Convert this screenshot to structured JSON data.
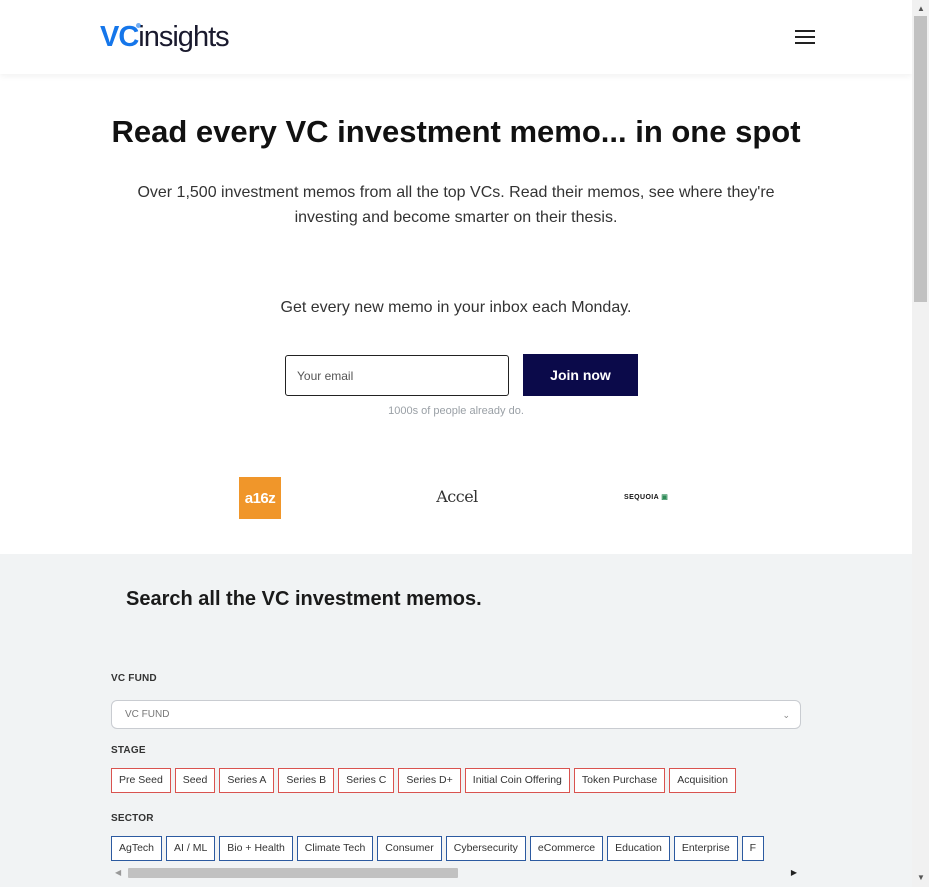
{
  "header": {
    "logo_vc": "VC",
    "logo_rest": "insights",
    "menu_icon": "hamburger-menu-icon"
  },
  "hero": {
    "title": "Read every VC investment memo... in one spot",
    "subtitle": "Over 1,500 investment memos from all the top VCs. Read their memos, see where they're investing and become smarter on their thesis.",
    "inbox_text": "Get every new memo in your inbox each Monday.",
    "email_placeholder": "Your email",
    "join_label": "Join now",
    "social_proof": "1000s of people already do."
  },
  "fund_logos": {
    "a16z": "a16z",
    "accel": "Accel",
    "sequoia": "SEQUOIA"
  },
  "search": {
    "title": "Search all the VC investment memos.",
    "fund_label": "VC FUND",
    "fund_placeholder": "VC FUND",
    "stage_label": "STAGE",
    "stages": [
      "Pre Seed",
      "Seed",
      "Series A",
      "Series B",
      "Series C",
      "Series D+",
      "Initial Coin Offering",
      "Token Purchase",
      "Acquisition"
    ],
    "sector_label": "SECTOR",
    "sectors": [
      "AgTech",
      "AI / ML",
      "Bio + Health",
      "Climate Tech",
      "Consumer",
      "Cybersecurity",
      "eCommerce",
      "Education",
      "Enterprise",
      "F"
    ]
  },
  "colors": {
    "brand_blue": "#1576ea",
    "button_navy": "#0b0a4a",
    "stage_border": "#d9534f",
    "sector_border": "#2c5aa0",
    "a16z_orange": "#f0962a"
  }
}
